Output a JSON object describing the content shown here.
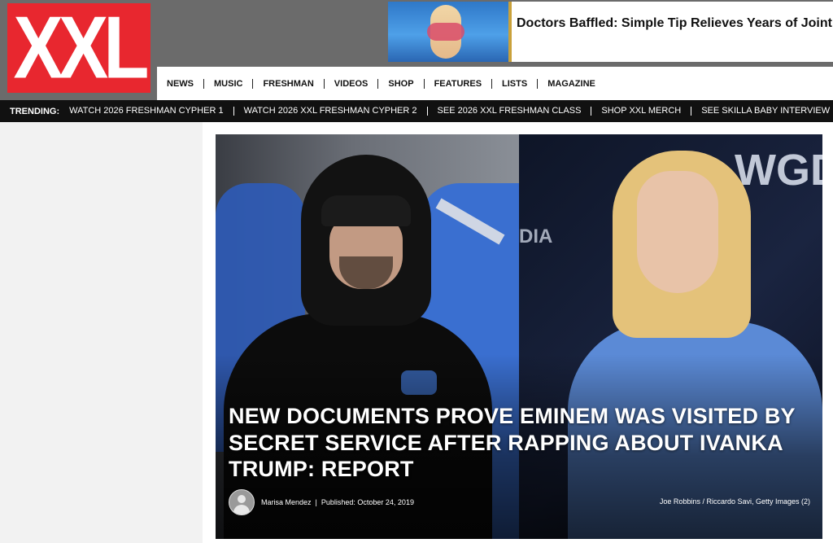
{
  "logo": {
    "text": "XXL"
  },
  "ad": {
    "text": "Doctors Baffled: Simple Tip Relieves Years of Joint Pain and Arthritis"
  },
  "nav": {
    "items": [
      "NEWS",
      "MUSIC",
      "FRESHMAN",
      "VIDEOS",
      "SHOP",
      "FEATURES",
      "LISTS",
      "MAGAZINE"
    ]
  },
  "trending": {
    "label": "TRENDING:",
    "items": [
      "WATCH 2026 FRESHMAN CYPHER 1",
      "WATCH 2026 XXL FRESHMAN CYPHER 2",
      "SEE 2026 XXL FRESHMAN CLASS",
      "SHOP XXL MERCH",
      "SEE SKILLA BABY INTERVIEW"
    ]
  },
  "hero": {
    "headline": "NEW DOCUMENTS PROVE EMINEM WAS VISITED BY SECRET SERVICE AFTER RAPPING ABOUT IVANKA TRUMP: REPORT",
    "author": "Marisa Mendez",
    "separator": "|",
    "published": "Published: October 24, 2019",
    "credit": "Joe Robbins / Riccardo Savi, Getty Images (2)",
    "backdrop_text": "WGD",
    "backdrop_text_2": "DIA"
  },
  "colors": {
    "brand_red": "#e8272f",
    "header_gray": "#6b6b6b",
    "trending_bg": "#111111"
  }
}
